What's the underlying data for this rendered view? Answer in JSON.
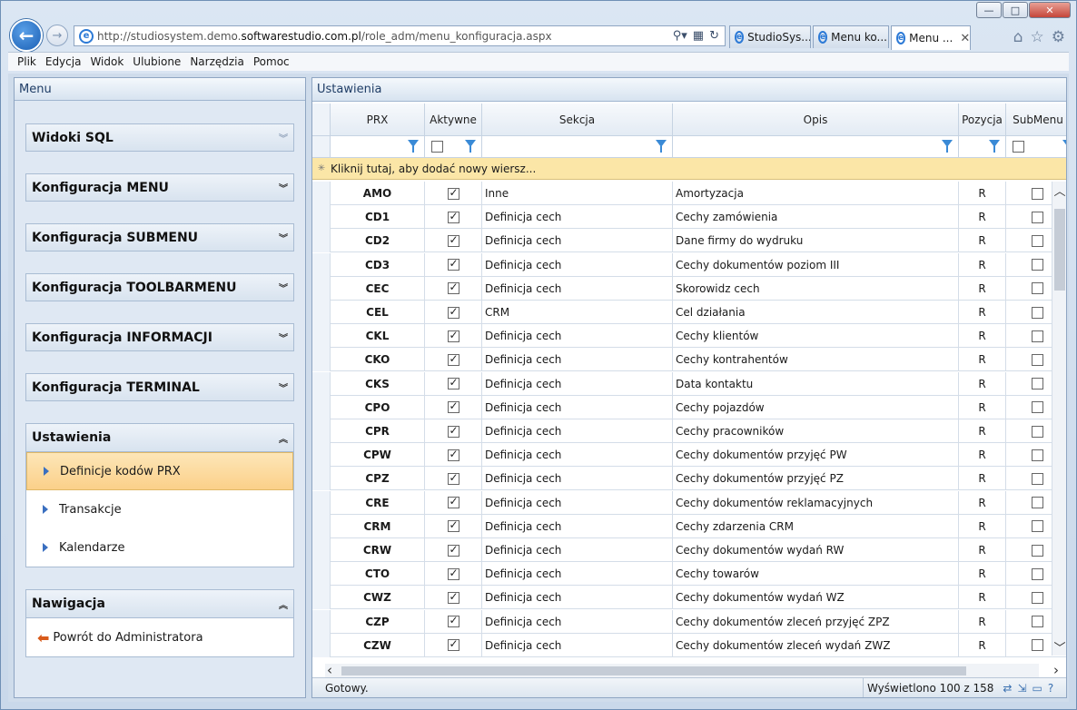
{
  "browser": {
    "window_controls": {
      "minimize": "—",
      "maximize": "□",
      "close": "✕"
    },
    "back": "←",
    "forward": "→",
    "url_prefix": "http://studiosystem.demo.",
    "url_domain": "softwarestudio.com.pl",
    "url_path": "/role_adm/menu_konfiguracja.aspx",
    "tabs": [
      {
        "label": "StudioSys...",
        "active": false
      },
      {
        "label": "Menu ko...",
        "active": false
      },
      {
        "label": "Menu ...",
        "active": true
      }
    ],
    "tab_close": "✕",
    "menu": [
      "Plik",
      "Edycja",
      "Widok",
      "Ulubione",
      "Narzędzia",
      "Pomoc"
    ]
  },
  "left_panel": {
    "title": "Menu",
    "sections": [
      {
        "label": "Widoki SQL",
        "state": "collapsed-faded"
      },
      {
        "label": "Konfiguracja MENU",
        "state": "collapsed"
      },
      {
        "label": "Konfiguracja SUBMENU",
        "state": "collapsed"
      },
      {
        "label": "Konfiguracja TOOLBARMENU",
        "state": "collapsed"
      },
      {
        "label": "Konfiguracja INFORMACJI",
        "state": "collapsed"
      },
      {
        "label": "Konfiguracja TERMINAL",
        "state": "collapsed"
      }
    ],
    "ustawienia": {
      "label": "Ustawienia",
      "items": [
        "Definicje kodów PRX",
        "Transakcje",
        "Kalendarze"
      ],
      "selected": 0
    },
    "nawigacja": {
      "label": "Nawigacja",
      "items": [
        "Powrót do Administratora"
      ]
    }
  },
  "right_panel": {
    "title": "Ustawienia",
    "columns": [
      "PRX",
      "Aktywne",
      "Sekcja",
      "Opis",
      "Pozycja",
      "SubMenu"
    ],
    "add_row": "Kliknij tutaj, aby dodać nowy wiersz...",
    "rows": [
      {
        "prx": "AMO",
        "sekcja": "Inne",
        "opis": "Amortyzacja",
        "pozycja": "R"
      },
      {
        "prx": "CD1",
        "sekcja": "Definicja cech",
        "opis": "Cechy zamówienia",
        "pozycja": "R"
      },
      {
        "prx": "CD2",
        "sekcja": "Definicja cech",
        "opis": "Dane firmy do wydruku",
        "pozycja": "R"
      },
      {
        "prx": "CD3",
        "sekcja": "Definicja cech",
        "opis": "Cechy dokumentów poziom III",
        "pozycja": "R"
      },
      {
        "prx": "CEC",
        "sekcja": "Definicja cech",
        "opis": "Skorowidz cech",
        "pozycja": "R"
      },
      {
        "prx": "CEL",
        "sekcja": "CRM",
        "opis": "Cel działania",
        "pozycja": "R"
      },
      {
        "prx": "CKL",
        "sekcja": "Definicja cech",
        "opis": "Cechy klientów",
        "pozycja": "R"
      },
      {
        "prx": "CKO",
        "sekcja": "Definicja cech",
        "opis": "Cechy kontrahentów",
        "pozycja": "R"
      },
      {
        "prx": "CKS",
        "sekcja": "Definicja cech",
        "opis": "Data kontaktu",
        "pozycja": "R"
      },
      {
        "prx": "CPO",
        "sekcja": "Definicja cech",
        "opis": "Cechy pojazdów",
        "pozycja": "R"
      },
      {
        "prx": "CPR",
        "sekcja": "Definicja cech",
        "opis": "Cechy pracowników",
        "pozycja": "R"
      },
      {
        "prx": "CPW",
        "sekcja": "Definicja cech",
        "opis": "Cechy dokumentów przyjęć PW",
        "pozycja": "R"
      },
      {
        "prx": "CPZ",
        "sekcja": "Definicja cech",
        "opis": "Cechy dokumentów przyjęć PZ",
        "pozycja": "R"
      },
      {
        "prx": "CRE",
        "sekcja": "Definicja cech",
        "opis": "Cechy dokumentów reklamacyjnych",
        "pozycja": "R"
      },
      {
        "prx": "CRM",
        "sekcja": "Definicja cech",
        "opis": "Cechy zdarzenia CRM",
        "pozycja": "R"
      },
      {
        "prx": "CRW",
        "sekcja": "Definicja cech",
        "opis": "Cechy dokumentów wydań RW",
        "pozycja": "R"
      },
      {
        "prx": "CTO",
        "sekcja": "Definicja cech",
        "opis": "Cechy towarów",
        "pozycja": "R"
      },
      {
        "prx": "CWZ",
        "sekcja": "Definicja cech",
        "opis": "Cechy dokumentów wydań WZ",
        "pozycja": "R"
      },
      {
        "prx": "CZP",
        "sekcja": "Definicja cech",
        "opis": "Cechy dokumentów zleceń przyjęć ZPZ",
        "pozycja": "R"
      },
      {
        "prx": "CZW",
        "sekcja": "Definicja cech",
        "opis": "Cechy dokumentów zleceń wydań ZWZ",
        "pozycja": "R"
      }
    ],
    "status": "Gotowy.",
    "count": "Wyświetlono 100 z 158"
  },
  "icons": {
    "home": "home-icon",
    "favorites": "star-icon",
    "tools": "gear-icon",
    "search": "search-icon",
    "refresh": "refresh-icon"
  }
}
